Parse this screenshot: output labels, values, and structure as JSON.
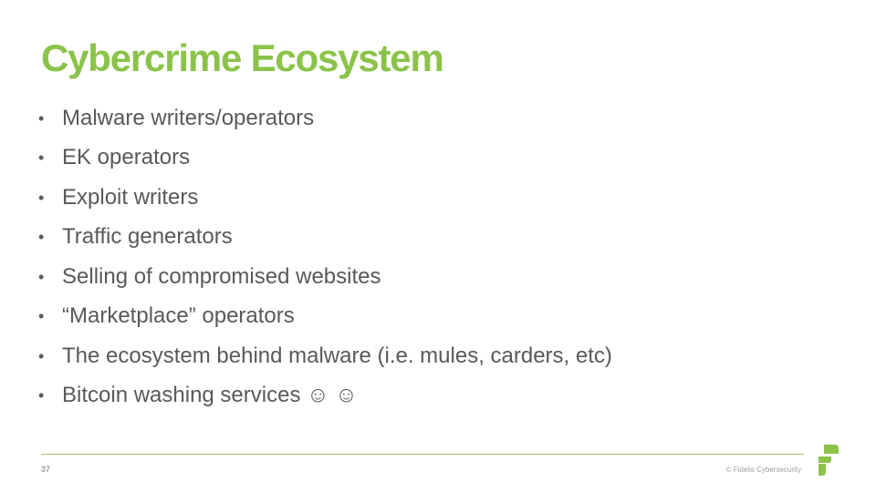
{
  "slide": {
    "title": "Cybercrime Ecosystem",
    "bullets": [
      "Malware writers/operators",
      "EK operators",
      "Exploit writers",
      "Traffic generators",
      "Selling of compromised websites",
      "“Marketplace” operators",
      "The ecosystem behind malware (i.e. mules, carders, etc)",
      "Bitcoin washing services ☺ ☺"
    ],
    "bullet_glyph": "•",
    "page_number": "37",
    "copyright": "© Fidelis Cybersecurity",
    "logo_icon": "fidelis-f-logo",
    "colors": {
      "title": "#8bc34a",
      "body": "#595959",
      "rule": "#a4c36b"
    }
  }
}
